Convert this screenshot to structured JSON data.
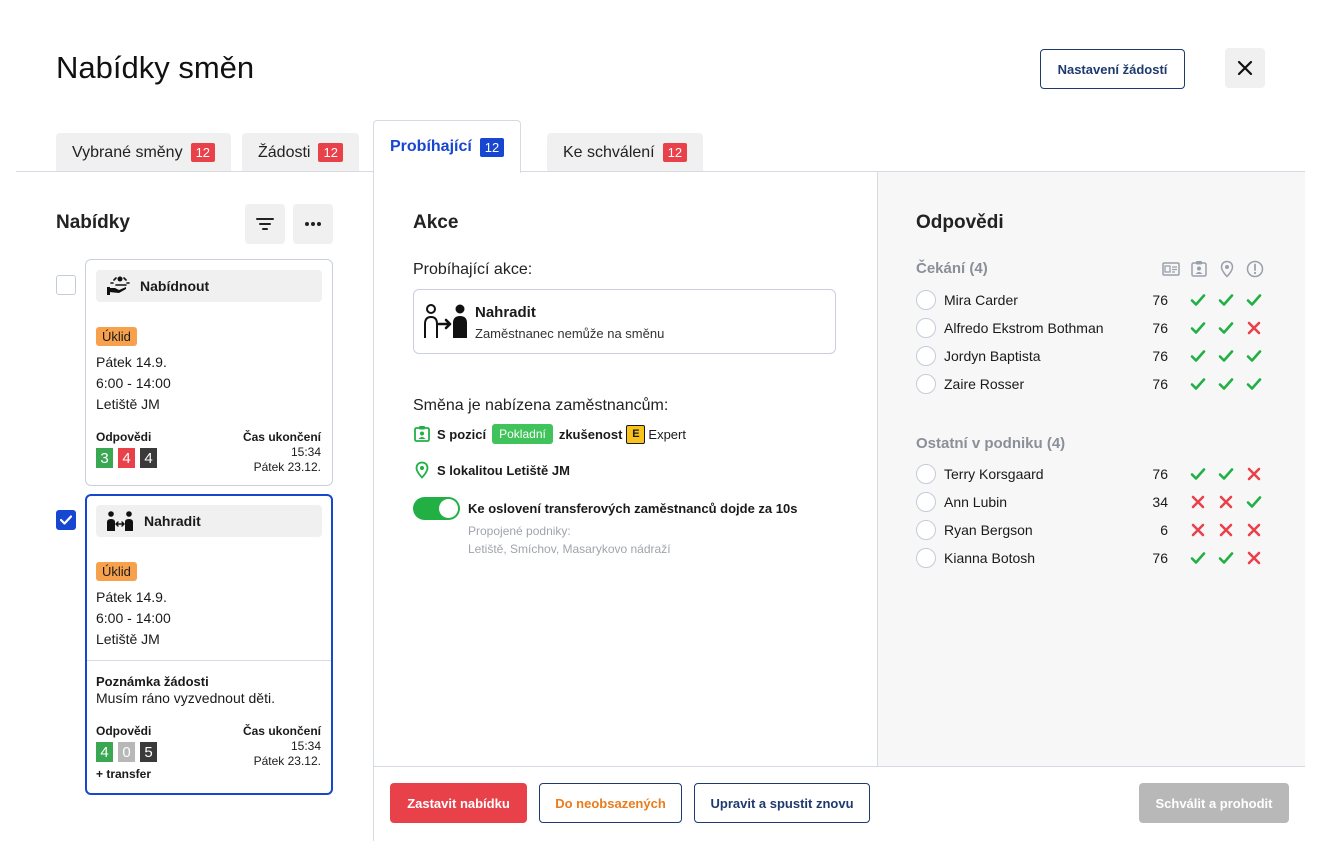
{
  "header": {
    "title": "Nabídky směn",
    "settings_label": "Nastavení žádostí",
    "close_icon": "close-icon"
  },
  "tabs": [
    {
      "label": "Vybrané směny",
      "count": "12",
      "active": false
    },
    {
      "label": "Žádosti",
      "count": "12",
      "active": false
    },
    {
      "label": "Probíhající",
      "count": "12",
      "active": true
    },
    {
      "label": "Ke schválení",
      "count": "12",
      "active": false
    }
  ],
  "left": {
    "title": "Nabídky",
    "filter_icon": "filter-icon",
    "more_icon": "more-icon",
    "cards": [
      {
        "checked": false,
        "action": "Nabídnout",
        "icon": "offer-icon",
        "tag": "Úklid",
        "date": "Pátek 14.9.",
        "time": "6:00 - 14:00",
        "location": "Letiště JM",
        "responses_label": "Odpovědi",
        "counts": [
          "3",
          "4",
          "4"
        ],
        "end_label": "Čas ukončení",
        "end_time": "15:34",
        "end_date": "Pátek 23.12."
      },
      {
        "checked": true,
        "action": "Nahradit",
        "icon": "swap-icon",
        "tag": "Úklid",
        "date": "Pátek 14.9.",
        "time": "6:00 - 14:00",
        "location": "Letiště JM",
        "note_label": "Poznámka žádosti",
        "note": "Musím ráno vyzvednout děti.",
        "responses_label": "Odpovědi",
        "counts": [
          "4",
          "0",
          "5"
        ],
        "transfer": "+ transfer",
        "end_label": "Čas ukončení",
        "end_time": "15:34",
        "end_date": "Pátek 23.12."
      }
    ]
  },
  "middle": {
    "title": "Akce",
    "running_label": "Probíhající akce:",
    "action": {
      "name": "Nahradit",
      "description": "Zaměstnanec nemůže na směnu",
      "icon": "replace-person-icon"
    },
    "offered_label": "Směna je nabízena zaměstnancům:",
    "position_prefix": "S pozicí",
    "position_tag": "Pokladní",
    "experience_label": "zkušenost",
    "experience_badge": "E",
    "experience_level": "Expert",
    "location_text": "S lokalitou Letiště JM",
    "toggle_on": true,
    "toggle_label": "Ke oslovení transferových zaměstnanců dojde za 10s",
    "linked_label": "Propojené podniky:",
    "linked_values": "Letiště, Smíchov, Masarykovo nádraží"
  },
  "right": {
    "title": "Odpovědi",
    "column_icons": [
      "id-card-icon",
      "badge-icon",
      "location-pin-icon",
      "alert-circle-icon"
    ],
    "groups": [
      {
        "title": "Čekání (4)",
        "rows": [
          {
            "name": "Mira Carder",
            "score": "76",
            "checks": [
              true,
              true,
              true
            ]
          },
          {
            "name": "Alfredo Ekstrom Bothman",
            "score": "76",
            "checks": [
              true,
              true,
              false
            ]
          },
          {
            "name": "Jordyn Baptista",
            "score": "76",
            "checks": [
              true,
              true,
              true
            ]
          },
          {
            "name": "Zaire Rosser",
            "score": "76",
            "checks": [
              true,
              true,
              true
            ]
          }
        ]
      },
      {
        "title": "Ostatní v podniku (4)",
        "rows": [
          {
            "name": "Terry Korsgaard",
            "score": "76",
            "checks": [
              true,
              true,
              false
            ]
          },
          {
            "name": "Ann Lubin",
            "score": "34",
            "checks": [
              false,
              false,
              true
            ]
          },
          {
            "name": "Ryan Bergson",
            "score": "6",
            "checks": [
              false,
              false,
              false
            ]
          },
          {
            "name": "Kianna Botosh",
            "score": "76",
            "checks": [
              true,
              true,
              false
            ]
          }
        ]
      }
    ]
  },
  "footer": {
    "stop_label": "Zastavit nabídku",
    "unfilled_label": "Do neobsazených",
    "edit_label": "Upravit a spustit znovu",
    "approve_label": "Schválit a prohodit"
  },
  "colors": {
    "accent": "#1746d1",
    "danger": "#e8414a",
    "success": "#22b045",
    "navy": "#1f3a6e"
  }
}
